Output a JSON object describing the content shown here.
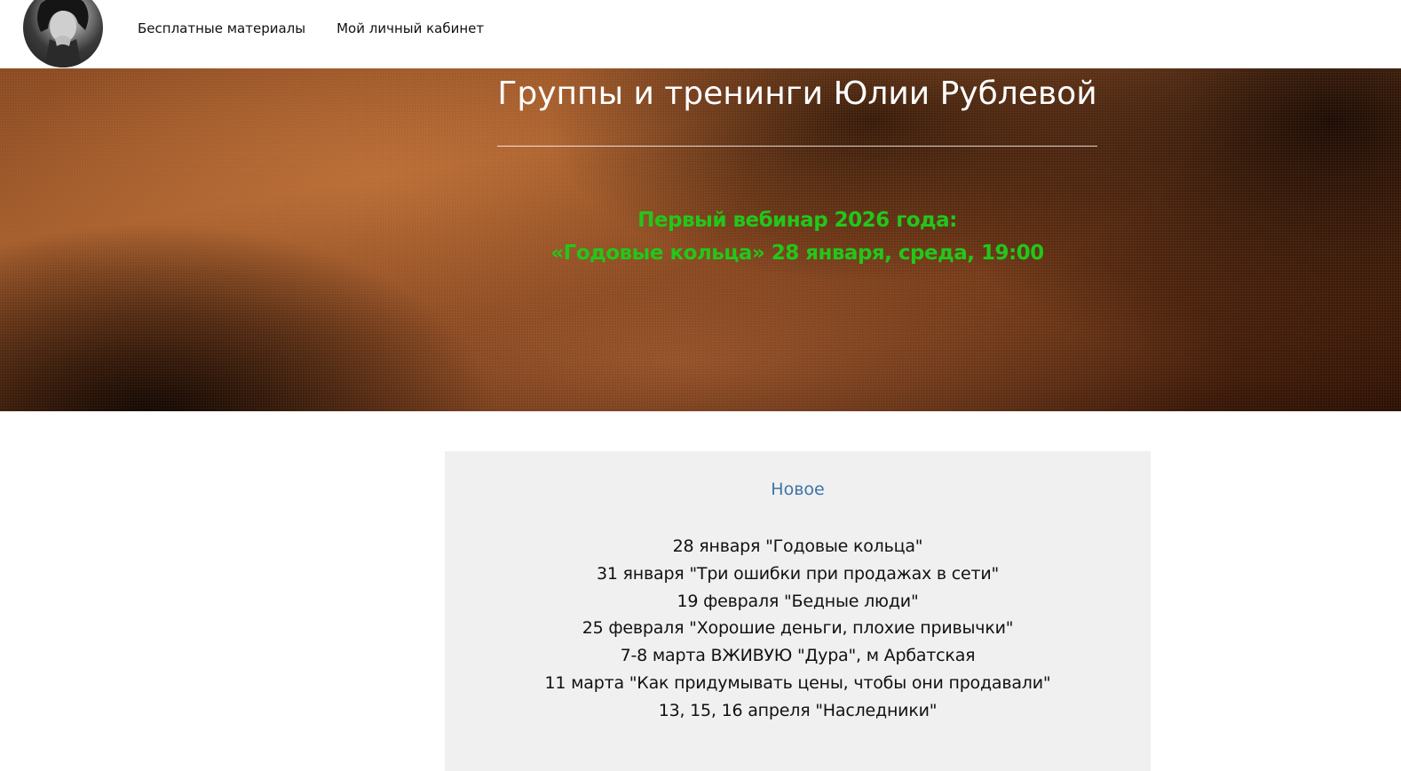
{
  "header": {
    "nav": [
      {
        "label": "Бесплатные материалы"
      },
      {
        "label": "Мой личный кабинет"
      }
    ]
  },
  "hero": {
    "title": "Группы и тренинги Юлии Рублевой",
    "announce_line1": "Первый вебинар 2026 года:",
    "announce_line2": "«Годовые кольца» 28 января, среда, 19:00"
  },
  "news": {
    "title": "Новое",
    "items": [
      "28 января \"Годовые кольца\"",
      "31 января \"Три ошибки при продажах в сети\"",
      "19 февраля \"Бедные люди\"",
      "25 февраля \"Хорошие деньги, плохие привычки\"",
      "7-8 марта ВЖИВУЮ \"Дура\", м Арбатская",
      "11 марта \"Как придумывать цены, чтобы они продавали\"",
      "13, 15, 16 апреля \"Наследники\""
    ]
  },
  "colors": {
    "announce": "#22c71a",
    "news_title": "#3f74a8",
    "news_bg": "#f0f0f0"
  }
}
